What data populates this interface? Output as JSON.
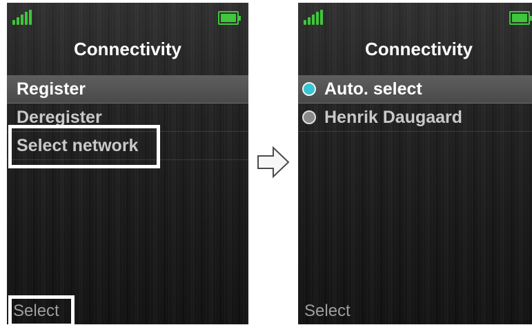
{
  "left_screen": {
    "title": "Connectivity",
    "menu_items": [
      {
        "label": "Register",
        "selected": true
      },
      {
        "label": "Deregister",
        "selected": false
      },
      {
        "label": "Select network",
        "selected": false
      }
    ],
    "softkey": "Select"
  },
  "right_screen": {
    "title": "Connectivity",
    "options": [
      {
        "label": "Auto. select",
        "checked": true
      },
      {
        "label": "Henrik Daugaard",
        "checked": false
      }
    ],
    "softkey": "Select"
  },
  "status_bar": {
    "signal_icon": "signal-strength-icon",
    "battery_icon": "battery-full-icon",
    "indicator_color": "#3fc63b"
  },
  "transition_icon": "arrow-right-icon",
  "colors": {
    "radio_selected": "#37c6d2",
    "radio_unselected": "#8a8a8a",
    "highlight": "#ffffff"
  }
}
